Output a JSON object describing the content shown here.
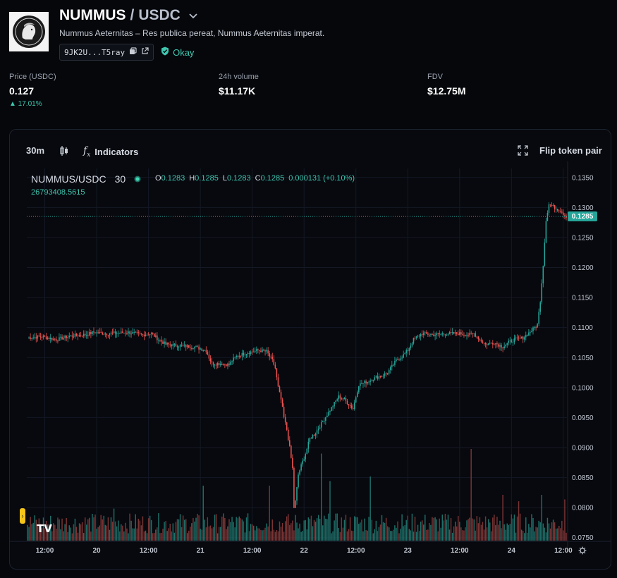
{
  "header": {
    "base_token": "NUMMUS",
    "separator": "/",
    "quote_token": "USDC",
    "subtitle": "Nummus Aeternitas – Res publica pereat, Nummus Aeternitas imperat.",
    "address": "9JK2U...T5ray",
    "audit_status": "Okay"
  },
  "stats": {
    "price_label": "Price (USDC)",
    "price_value": "0.127",
    "price_change": "▲ 17.01%",
    "volume_label": "24h volume",
    "volume_value": "$11.17K",
    "fdv_label": "FDV",
    "fdv_value": "$12.75M"
  },
  "toolbar": {
    "interval": "30m",
    "indicators_label": "Indicators",
    "flip_label": "Flip token pair"
  },
  "legend": {
    "symbol": "NUMMUS/USDC",
    "interval": "30",
    "open_label": "O",
    "open_value": "0.1283",
    "high_label": "H",
    "high_value": "0.1285",
    "low_label": "L",
    "low_value": "0.1283",
    "close_label": "C",
    "close_value": "0.1285",
    "change": "0.000131 (+0.10%)",
    "volume": "26793408.5615"
  },
  "colors": {
    "up": "#26a69a",
    "down": "#ef5350",
    "accent": "#3fc7b0"
  },
  "chart_data": {
    "type": "candlestick",
    "current_price_label": "0.1285",
    "y_ticks": [
      "0.1350",
      "0.1300",
      "0.1250",
      "0.1200",
      "0.1150",
      "0.1100",
      "0.1050",
      "0.1000",
      "0.0950",
      "0.0900",
      "0.0850",
      "0.0800",
      "0.0750"
    ],
    "y_tick_values": [
      0.135,
      0.13,
      0.125,
      0.12,
      0.115,
      0.11,
      0.105,
      0.1,
      0.095,
      0.09,
      0.085,
      0.08,
      0.075
    ],
    "ylim": [
      0.0745,
      0.1365
    ],
    "x_ticks": [
      "12:00",
      "20",
      "12:00",
      "21",
      "12:00",
      "22",
      "12:00",
      "23",
      "12:00",
      "24",
      "12:00"
    ],
    "x_tick_index": [
      12,
      48,
      84,
      120,
      156,
      192,
      228,
      264,
      300,
      336,
      372
    ],
    "n_candles": 375,
    "close_path": [
      [
        0,
        0.1083
      ],
      [
        10,
        0.1085
      ],
      [
        20,
        0.108
      ],
      [
        30,
        0.1086
      ],
      [
        40,
        0.1088
      ],
      [
        46,
        0.1092
      ],
      [
        55,
        0.109
      ],
      [
        70,
        0.1092
      ],
      [
        80,
        0.1088
      ],
      [
        86,
        0.109
      ],
      [
        90,
        0.1082
      ],
      [
        96,
        0.1072
      ],
      [
        105,
        0.107
      ],
      [
        115,
        0.1068
      ],
      [
        120,
        0.1065
      ],
      [
        124,
        0.1062
      ],
      [
        126,
        0.105
      ],
      [
        128,
        0.104
      ],
      [
        135,
        0.104
      ],
      [
        140,
        0.1038
      ],
      [
        142,
        0.1045
      ],
      [
        145,
        0.1052
      ],
      [
        152,
        0.1058
      ],
      [
        160,
        0.1062
      ],
      [
        166,
        0.106
      ],
      [
        168,
        0.1052
      ],
      [
        170,
        0.1045
      ],
      [
        172,
        0.1032
      ],
      [
        174,
        0.1
      ],
      [
        176,
        0.098
      ],
      [
        178,
        0.095
      ],
      [
        180,
        0.093
      ],
      [
        182,
        0.09
      ],
      [
        184,
        0.0865
      ],
      [
        185,
        0.08
      ],
      [
        186,
        0.081
      ],
      [
        188,
        0.0855
      ],
      [
        190,
        0.087
      ],
      [
        193,
        0.089
      ],
      [
        196,
        0.0915
      ],
      [
        200,
        0.0925
      ],
      [
        204,
        0.094
      ],
      [
        208,
        0.0955
      ],
      [
        212,
        0.097
      ],
      [
        216,
        0.0985
      ],
      [
        220,
        0.098
      ],
      [
        224,
        0.097
      ],
      [
        226,
        0.0965
      ],
      [
        230,
        0.1005
      ],
      [
        236,
        0.101
      ],
      [
        240,
        0.1015
      ],
      [
        246,
        0.102
      ],
      [
        250,
        0.1025
      ],
      [
        256,
        0.1045
      ],
      [
        260,
        0.1052
      ],
      [
        264,
        0.1062
      ],
      [
        268,
        0.108
      ],
      [
        274,
        0.109
      ],
      [
        282,
        0.1088
      ],
      [
        292,
        0.109
      ],
      [
        300,
        0.109
      ],
      [
        306,
        0.1088
      ],
      [
        310,
        0.109
      ],
      [
        314,
        0.108
      ],
      [
        318,
        0.1072
      ],
      [
        324,
        0.1075
      ],
      [
        328,
        0.107
      ],
      [
        330,
        0.1068
      ],
      [
        334,
        0.1075
      ],
      [
        338,
        0.108
      ],
      [
        344,
        0.1083
      ],
      [
        350,
        0.1095
      ],
      [
        354,
        0.1105
      ],
      [
        356,
        0.1145
      ],
      [
        358,
        0.1205
      ],
      [
        360,
        0.128
      ],
      [
        362,
        0.1305
      ],
      [
        366,
        0.13
      ],
      [
        370,
        0.1295
      ],
      [
        374,
        0.1285
      ],
      [
        376,
        0.1265
      ],
      [
        378,
        0.1245
      ],
      [
        380,
        0.122
      ],
      [
        382,
        0.119
      ],
      [
        384,
        0.1205
      ],
      [
        386,
        0.1215
      ],
      [
        388,
        0.121
      ],
      [
        390,
        0.1255
      ],
      [
        392,
        0.1283
      ],
      [
        393,
        0.1285
      ]
    ],
    "volume_spikes": [
      [
        60,
        0.35
      ],
      [
        122,
        0.6
      ],
      [
        168,
        0.6
      ],
      [
        204,
        0.95
      ],
      [
        210,
        0.65
      ],
      [
        238,
        0.7
      ],
      [
        308,
        1.0
      ],
      [
        330,
        0.5
      ],
      [
        341,
        0.43
      ],
      [
        357,
        0.5
      ],
      [
        373,
        0.45
      ],
      [
        382,
        0.6
      ]
    ]
  }
}
